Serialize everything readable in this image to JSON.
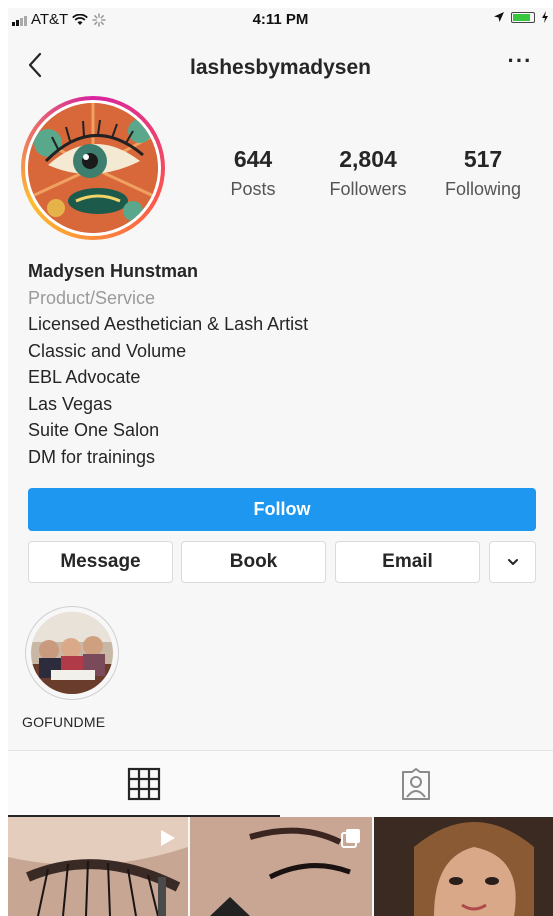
{
  "status_bar": {
    "carrier": "AT&T",
    "time": "4:11 PM",
    "battery_level": 0.85
  },
  "nav": {
    "username": "lashesbymadysen",
    "back_icon": "chevron-left-icon",
    "more_icon": "more-horizontal-icon",
    "more_label": "···"
  },
  "profile": {
    "stats": [
      {
        "value": "644",
        "label": "Posts"
      },
      {
        "value": "2,804",
        "label": "Followers"
      },
      {
        "value": "517",
        "label": "Following"
      }
    ]
  },
  "bio": {
    "name": "Madysen Hunstman",
    "category": "Product/Service",
    "lines": [
      "Licensed Aesthetician & Lash Artist",
      "Classic and Volume",
      "EBL Advocate",
      "Las Vegas",
      "Suite One Salon",
      "DM for trainings"
    ]
  },
  "actions": {
    "follow": "Follow",
    "message": "Message",
    "book": "Book",
    "email": "Email"
  },
  "highlights": [
    {
      "label": "GOFUNDME"
    }
  ],
  "tabs": [
    {
      "icon": "grid-icon"
    },
    {
      "icon": "tagged-person-icon"
    }
  ],
  "colors": {
    "follow_blue": "#1e97f0",
    "background": "#f7f7f7",
    "text": "#262626",
    "muted": "#9a9a9a"
  }
}
